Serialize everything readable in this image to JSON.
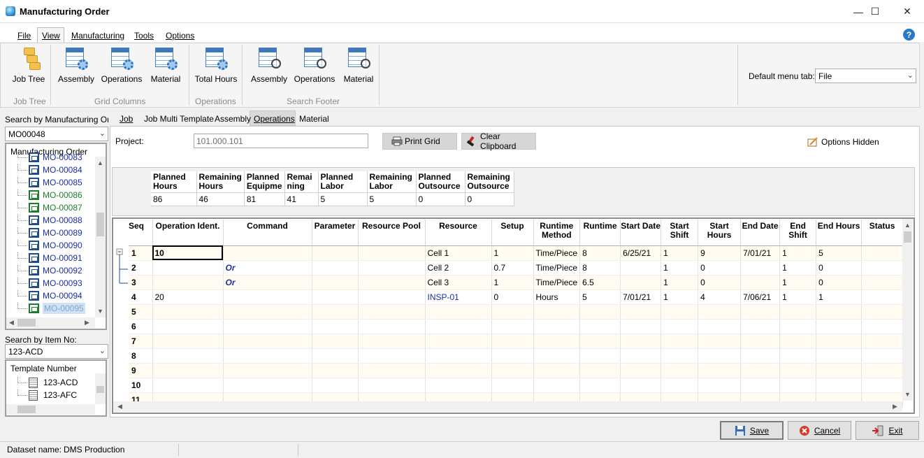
{
  "window": {
    "title": "Manufacturing Order",
    "minimize": "—",
    "maximize": "☐",
    "close": "✕"
  },
  "menu": [
    "File",
    "View",
    "Manufacturing",
    "Tools",
    "Options"
  ],
  "help": "?",
  "ribbon": {
    "job_tree": {
      "label": "Job Tree",
      "group": "Job Tree"
    },
    "grid_columns": {
      "group": "Grid Columns",
      "buttons": [
        "Assembly",
        "Operations",
        "Material"
      ]
    },
    "operations": {
      "group": "Operations",
      "buttons": [
        "Total Hours"
      ]
    },
    "search_footer": {
      "group": "Search Footer",
      "buttons": [
        "Assembly",
        "Operations",
        "Material"
      ]
    },
    "default_menu_tab_label": "Default menu tab:",
    "default_menu_tab_value": "File"
  },
  "left": {
    "search_mo_label": "Search by Manufacturing Order",
    "search_mo_value": "MO00048",
    "tree_header": "Manufacturing Order",
    "orders": [
      {
        "id": "MO-00083",
        "green": false
      },
      {
        "id": "MO-00084",
        "green": false
      },
      {
        "id": "MO-00085",
        "green": false
      },
      {
        "id": "MO-00086",
        "green": true
      },
      {
        "id": "MO-00087",
        "green": true
      },
      {
        "id": "MO-00088",
        "green": false
      },
      {
        "id": "MO-00089",
        "green": false
      },
      {
        "id": "MO-00090",
        "green": false
      },
      {
        "id": "MO-00091",
        "green": false
      },
      {
        "id": "MO-00092",
        "green": false
      },
      {
        "id": "MO-00093",
        "green": false
      },
      {
        "id": "MO-00094",
        "green": false
      },
      {
        "id": "MO-00095",
        "green": true,
        "selected": true
      }
    ],
    "search_item_label": "Search by Item No:",
    "search_item_value": "123-ACD",
    "template_header": "Template Number",
    "templates": [
      "123-ACD",
      "123-AFC"
    ]
  },
  "tabs": [
    "Job",
    "Job Multi Template",
    "Assembly",
    "Operations",
    "Material"
  ],
  "active_tab": "Operations",
  "project": {
    "label": "Project:",
    "value": "101.000.101"
  },
  "buttons": {
    "print_grid": "Print Grid",
    "clear_clipboard": "Clear Clipboard",
    "options_hidden": "Options Hidden"
  },
  "summary": {
    "headers": [
      "Planned Hours",
      "Remaining Hours",
      "Planned Equipme",
      "Remai ning",
      "Planned Labor",
      "Remaining Labor",
      "Planned Outsource",
      "Remaining Outsource"
    ],
    "values": [
      "86",
      "46",
      "81",
      "41",
      "5",
      "5",
      "0",
      "0"
    ]
  },
  "grid": {
    "headers": [
      "Seq",
      "Operation Ident.",
      "Command",
      "Parameter",
      "Resource Pool",
      "Resource",
      "Setup",
      "Runtime Method",
      "Runtime",
      "Start Date",
      "Start Shift",
      "Start Hours",
      "End Date",
      "End Shift",
      "End Hours",
      "Status"
    ],
    "rows": [
      [
        "1",
        "10",
        "",
        "",
        "",
        "Cell 1",
        "1",
        "Time/Piece",
        "8",
        "6/25/21",
        "1",
        "9",
        "7/01/21",
        "1",
        "5",
        ""
      ],
      [
        "2",
        "",
        "Or",
        "",
        "",
        "Cell 2",
        "0.7",
        "Time/Piece",
        "8",
        "",
        "1",
        "0",
        "",
        "1",
        "0",
        ""
      ],
      [
        "3",
        "",
        "Or",
        "",
        "",
        "Cell 3",
        "1",
        "Time/Piece",
        "6.5",
        "",
        "1",
        "0",
        "",
        "1",
        "0",
        ""
      ],
      [
        "4",
        "20",
        "",
        "",
        "",
        "INSP-01",
        "0",
        "Hours",
        "5",
        "7/01/21",
        "1",
        "4",
        "7/06/21",
        "1",
        "1",
        ""
      ],
      [
        "5",
        "",
        "",
        "",
        "",
        "",
        "",
        "",
        "",
        "",
        "",
        "",
        "",
        "",
        "",
        ""
      ],
      [
        "6",
        "",
        "",
        "",
        "",
        "",
        "",
        "",
        "",
        "",
        "",
        "",
        "",
        "",
        "",
        ""
      ],
      [
        "7",
        "",
        "",
        "",
        "",
        "",
        "",
        "",
        "",
        "",
        "",
        "",
        "",
        "",
        "",
        ""
      ],
      [
        "8",
        "",
        "",
        "",
        "",
        "",
        "",
        "",
        "",
        "",
        "",
        "",
        "",
        "",
        "",
        ""
      ],
      [
        "9",
        "",
        "",
        "",
        "",
        "",
        "",
        "",
        "",
        "",
        "",
        "",
        "",
        "",
        "",
        ""
      ],
      [
        "10",
        "",
        "",
        "",
        "",
        "",
        "",
        "",
        "",
        "",
        "",
        "",
        "",
        "",
        "",
        ""
      ],
      [
        "11",
        "",
        "",
        "",
        "",
        "",
        "",
        "",
        "",
        "",
        "",
        "",
        "",
        "",
        "",
        ""
      ]
    ]
  },
  "footer": {
    "save": "Save",
    "cancel": "Cancel",
    "exit": "Exit"
  },
  "status": {
    "dataset_label": "Dataset name:",
    "dataset_value": "DMS Production"
  },
  "colors": {
    "link_blue": "#1c2fa6",
    "green": "#1e7d2c",
    "accent": "#2a78c8"
  }
}
